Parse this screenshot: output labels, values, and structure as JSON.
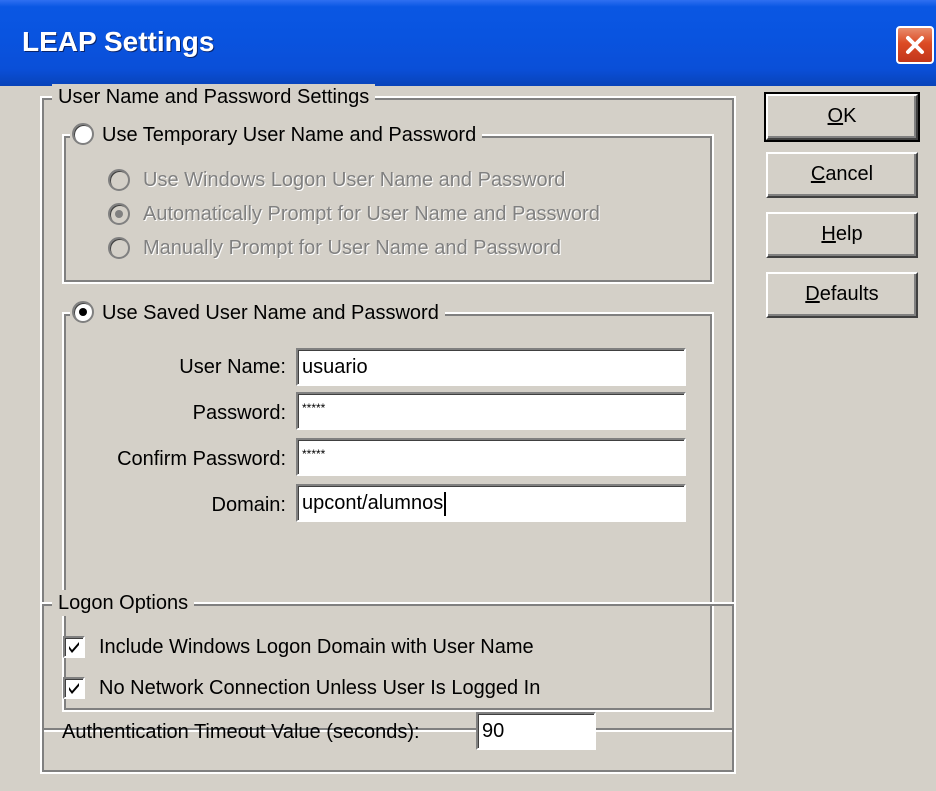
{
  "window": {
    "title": "LEAP Settings"
  },
  "credentials_group": {
    "legend": "User Name and Password Settings",
    "temporary": {
      "label": "Use Temporary User Name and Password",
      "selected": false,
      "options": [
        {
          "label": "Use Windows Logon User Name and Password",
          "selected": false
        },
        {
          "label": "Automatically Prompt for User Name and Password",
          "selected": true
        },
        {
          "label": "Manually Prompt for User Name and Password",
          "selected": false
        }
      ]
    },
    "saved": {
      "label": "Use Saved User Name and Password",
      "selected": true,
      "fields": {
        "username": {
          "label": "User Name:",
          "value": "usuario"
        },
        "password": {
          "label": "Password:",
          "value": "*****"
        },
        "confirm": {
          "label": "Confirm Password:",
          "value": "*****"
        },
        "domain": {
          "label": "Domain:",
          "value": "upcont/alumnos"
        }
      }
    }
  },
  "logon_group": {
    "legend": "Logon Options",
    "include_domain": {
      "label": "Include Windows Logon Domain with User Name",
      "checked": true
    },
    "no_network": {
      "label": "No Network Connection Unless User Is Logged In",
      "checked": true
    },
    "timeout": {
      "label": "Authentication Timeout Value (seconds):",
      "value": "90"
    }
  },
  "buttons": {
    "ok": {
      "mnemonic": "O",
      "rest": "K"
    },
    "cancel": {
      "mnemonic": "C",
      "rest": "ancel"
    },
    "help": {
      "mnemonic": "H",
      "rest": "elp"
    },
    "defaults": {
      "mnemonic": "D",
      "rest": "efaults"
    }
  }
}
